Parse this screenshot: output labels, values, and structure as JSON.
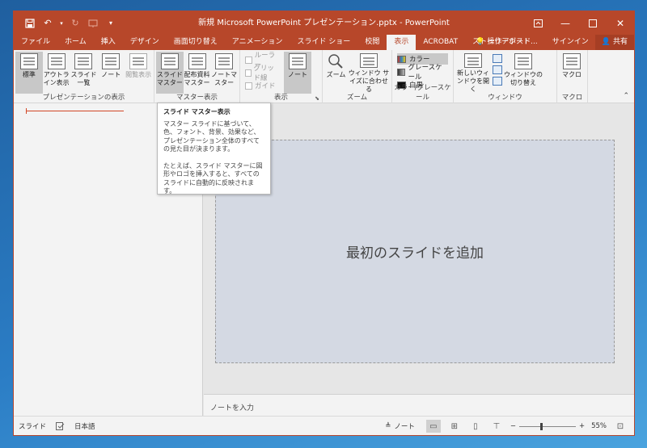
{
  "window": {
    "title": "新規 Microsoft PowerPoint プレゼンテーション.pptx - PowerPoint"
  },
  "quick_access": {
    "save_icon": "save-icon",
    "undo_icon": "undo-icon",
    "redo_icon": "redo-icon",
    "start_icon": "start-from-beginning-icon"
  },
  "tabs": [
    "ファイル",
    "ホーム",
    "挿入",
    "デザイン",
    "画面切り替え",
    "アニメーション",
    "スライド ショー",
    "校閲",
    "表示",
    "ACROBAT",
    "ストーリーボード"
  ],
  "active_tab": "表示",
  "tell_me": "操作アシスト...",
  "signin": "サインイン",
  "share": "共有",
  "ribbon": {
    "presentation_views": {
      "label": "プレゼンテーションの表示",
      "normal": "標準",
      "outline": "アウトライン表示",
      "slide_sorter": "スライド一覧",
      "notes_page": "ノート",
      "reading_view": "閲覧表示"
    },
    "master_views": {
      "label": "マスター表示",
      "slide_master": "スライドマスター",
      "handout_master": "配布資料マスター",
      "notes_master": "ノートマスター"
    },
    "show": {
      "label": "表示",
      "ruler": "ルーラー",
      "gridlines": "グリッド線",
      "guides": "ガイド",
      "notes": "ノート"
    },
    "zoom": {
      "label": "ズーム",
      "zoom": "ズーム",
      "fit": "ウィンドウ サイズに合わせる"
    },
    "color": {
      "label": "カラー/グレースケール",
      "color": "カラー",
      "grayscale": "グレースケール",
      "bw": "白黒"
    },
    "window": {
      "label": "ウィンドウ",
      "new_window": "新しいウィンドウを開く",
      "switch": "ウィンドウの切り替え"
    },
    "macros": {
      "label": "マクロ",
      "macros": "マクロ"
    }
  },
  "tooltip": {
    "title": "スライド マスター表示",
    "p1": "マスター スライドに基づいて、色、フォント、背景、効果など、プレゼンテーション全体のすべての見た目が決まります。",
    "p2": "たとえば、スライド マスターに図形やロゴを挿入すると、すべてのスライドに自動的に反映されます。"
  },
  "slide": {
    "placeholder": "最初のスライドを追加"
  },
  "notes_placeholder": "ノートを入力",
  "status": {
    "slide": "スライド",
    "language": "日本語",
    "notes": "ノート",
    "zoom": "55%"
  },
  "colors": {
    "accent": "#b7472a",
    "slide_bg": "#d4d9e3"
  }
}
